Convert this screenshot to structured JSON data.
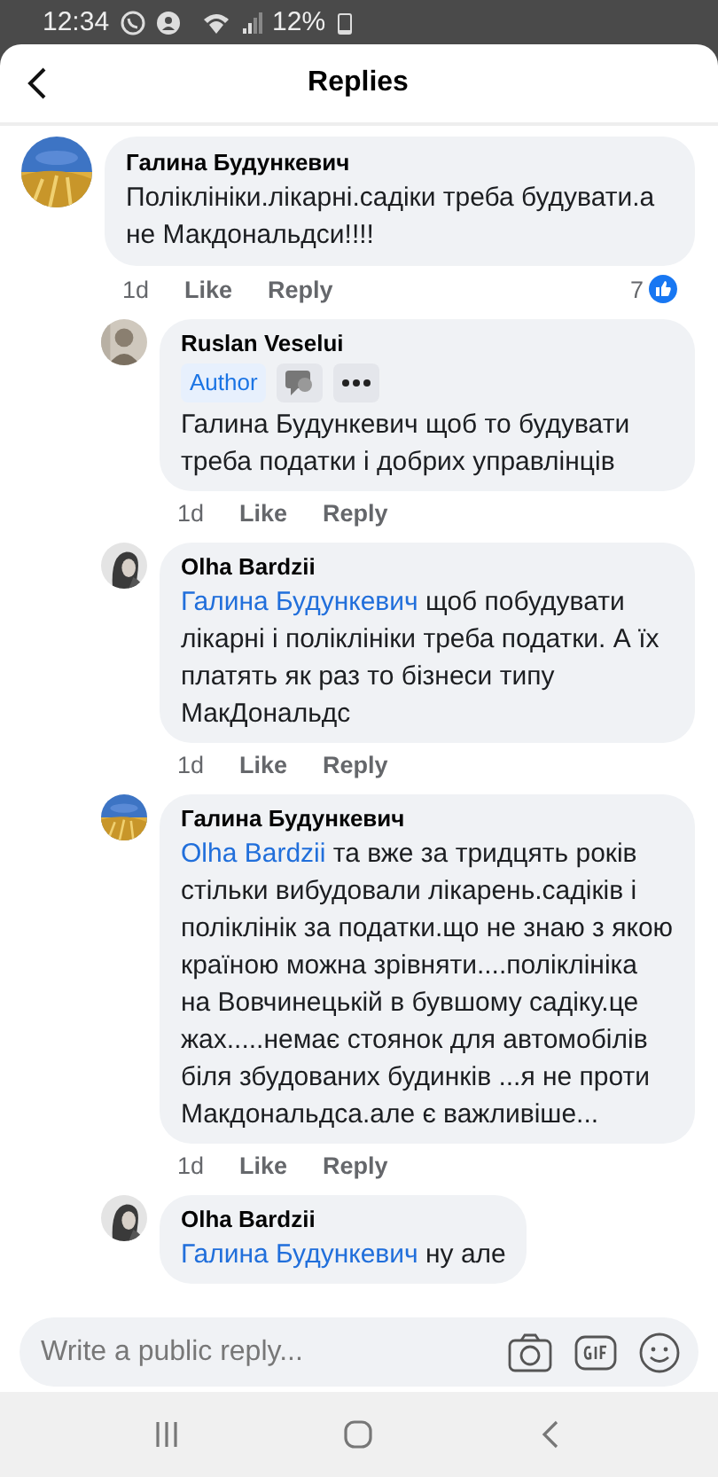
{
  "status_bar": {
    "time": "12:34",
    "battery": "12%"
  },
  "header": {
    "title": "Replies"
  },
  "comment": {
    "author": "Галина Будункевич",
    "text": "Поліклініки.лікарні.садіки треба будувати.а не Макдональдси!!!!",
    "time": "1d",
    "like": "Like",
    "reply": "Reply",
    "reactions": "7",
    "replies": [
      {
        "author": "Ruslan Veselui",
        "badge": "Author",
        "text": "Галина Будункевич щоб то будувати треба податки і добрих управлінців",
        "time": "1d",
        "like": "Like",
        "reply": "Reply"
      },
      {
        "author": "Olha Bardzii",
        "mention": "Галина Будункевич",
        "text": "щоб побудувати лікарні і поліклініки треба податки. А їх платять як раз то бізнеси типу МакДональдс",
        "time": "1d",
        "like": "Like",
        "reply": "Reply"
      },
      {
        "author": "Галина Будункевич",
        "mention": "Olha Bardzii",
        "text": "та вже за тридцять років стільки вибудовали лікарень.садіків і поліклінік за податки.що не знаю з якою країною можна зрівняти....поліклініка на Вовчинецькій в бувшому садіку.це жах.....немає стоянок для автомобілів біля збудованих будинків ...я не проти Макдональдса.але є важливіше...",
        "time": "1d",
        "like": "Like",
        "reply": "Reply"
      },
      {
        "author": "Olha Bardzii",
        "mention": "Галина Будункевич",
        "text": "ну але"
      }
    ]
  },
  "composer": {
    "placeholder": "Write a public reply..."
  }
}
